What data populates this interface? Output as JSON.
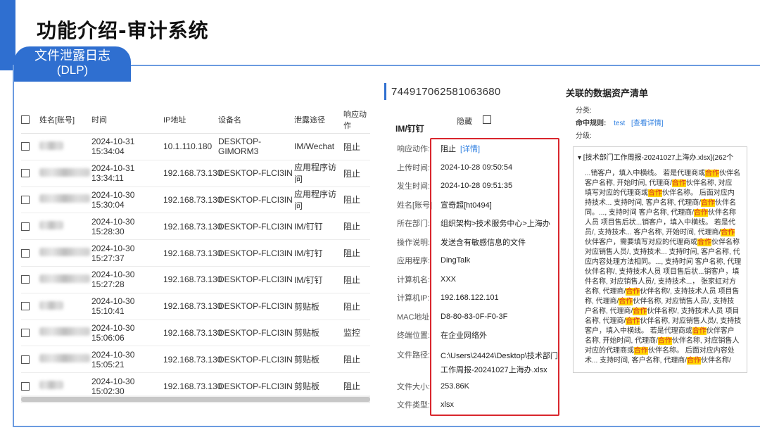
{
  "slide": {
    "title": "功能介绍-审计系统"
  },
  "badge": {
    "line1": "文件泄露日志",
    "line2": "(DLP)"
  },
  "table": {
    "headers": [
      "姓名[账号]",
      "时间",
      "IP地址",
      "设备名",
      "泄露途径",
      "响应动作"
    ],
    "rows": [
      {
        "time": "2024-10-31 15:34:04",
        "ip": "10.1.110.180",
        "device": "DESKTOP-GIMORM3",
        "path": "IM/Wechat",
        "action": "阻止"
      },
      {
        "time": "2024-10-31 13:34:11",
        "ip": "192.168.73.130",
        "device": "DESKTOP-FLCI3IN",
        "path": "应用程序访问",
        "action": "阻止"
      },
      {
        "time": "2024-10-30 15:30:04",
        "ip": "192.168.73.130",
        "device": "DESKTOP-FLCI3IN",
        "path": "应用程序访问",
        "action": "阻止"
      },
      {
        "time": "2024-10-30 15:28:30",
        "ip": "192.168.73.130",
        "device": "DESKTOP-FLCI3IN",
        "path": "IM/钉钉",
        "action": "阻止"
      },
      {
        "time": "2024-10-30 15:27:37",
        "ip": "192.168.73.130",
        "device": "DESKTOP-FLCI3IN",
        "path": "IM/钉钉",
        "action": "阻止"
      },
      {
        "time": "2024-10-30 15:27:28",
        "ip": "192.168.73.130",
        "device": "DESKTOP-FLCI3IN",
        "path": "IM/钉钉",
        "action": "阻止"
      },
      {
        "time": "2024-10-30 15:10:41",
        "ip": "192.168.73.130",
        "device": "DESKTOP-FLCI3IN",
        "path": "剪贴板",
        "action": "阻止"
      },
      {
        "time": "2024-10-30 15:06:06",
        "ip": "192.168.73.130",
        "device": "DESKTOP-FLCI3IN",
        "path": "剪贴板",
        "action": "监控"
      },
      {
        "time": "2024-10-30 15:05:21",
        "ip": "192.168.73.130",
        "device": "DESKTOP-FLCI3IN",
        "path": "剪贴板",
        "action": "阻止"
      },
      {
        "time": "2024-10-30 15:02:30",
        "ip": "192.168.73.130",
        "device": "DESKTOP-FLCI3IN",
        "path": "剪贴板",
        "action": "阻止"
      }
    ]
  },
  "detail": {
    "id": "744917062581063680",
    "hide_label": "隐藏",
    "section_title": "IM/钉钉",
    "fields": {
      "action": {
        "k": "响应动作:",
        "v": "阻止",
        "link": "[详情]"
      },
      "upload": {
        "k": "上传时间:",
        "v": "2024-10-28 09:50:54"
      },
      "occur": {
        "k": "发生时间:",
        "v": "2024-10-28 09:51:35"
      },
      "name": {
        "k": "姓名[账号]",
        "v": "宣奇超[ht0494]"
      },
      "dept": {
        "k": "所在部门:",
        "v": "组织架构>技术服务中心>上海办"
      },
      "op": {
        "k": "操作说明:",
        "v": "发送含有敏感信息的文件"
      },
      "app": {
        "k": "应用程序:",
        "v": "DingTalk"
      },
      "pc": {
        "k": "计算机名:",
        "v": "XXX"
      },
      "pcip": {
        "k": "计算机IP:",
        "v": "192.168.122.101"
      },
      "mac": {
        "k": "MAC地址:",
        "v": "D8-80-83-0F-F0-3F"
      },
      "loc": {
        "k": "终端位置:",
        "v": "在企业网络外"
      },
      "fpath": {
        "k": "文件路径:",
        "v": "C:\\Users\\24424\\Desktop\\技术部门工作周报-20241027上海办.xlsx"
      },
      "fsize": {
        "k": "文件大小:",
        "v": "253.86K"
      },
      "ftype": {
        "k": "文件类型:",
        "v": "xlsx"
      }
    }
  },
  "assets": {
    "title": "关联的数据资产清单",
    "category_label": "分类:",
    "rule_label": "命中规则:",
    "rule_value": "test",
    "rule_link": "[查看详情]",
    "level_label": "分级:",
    "file_head": "▾ [技术部门工作周报-20241027上海办.xlsx](262个",
    "snippet_lines": [
      [
        "...销客户，填入中横线。 若是代理商或",
        "合作",
        "伙伴名"
      ],
      [
        "客户名称, 开始时间, 代理商/",
        "合作",
        "伙伴名称, 对应"
      ],
      [
        "填写对应的代理商或",
        "合作",
        "伙伴名称。 后面对应内"
      ],
      [
        "持技术... 支持时间, 客户名称, 代理商/",
        "合作",
        "伙伴名"
      ],
      [
        "同。..., 支持时间 客户名称, 代理商/",
        "合作",
        "伙伴名称"
      ],
      [
        "人员 项目售后状...销客户，填入中横线。 若是代"
      ],
      [
        "员/, 支持技术... 客户名称, 开始时间, 代理商/",
        "合作",
        ""
      ],
      [
        "伙伴客户，需要填写对应的代理商或",
        "合作",
        "伙伴名称"
      ],
      [
        "对应销售人员/, 支持技术... 支持时间, 客户名称, 代"
      ],
      [
        "应内容处理方法相同。..., 支持时间 客户名称, 代理"
      ],
      [
        "伙伴名称/, 支持技术人员 项目售后状...销客户，填"
      ],
      [
        "件名称, 对应销售人员/, 支持技术...， 张家虹对方"
      ],
      [
        "名称, 代理商/",
        "合作",
        "伙伴名称/, 支持技术人员 项目售"
      ],
      [
        "称, 代理商/",
        "合作",
        "伙伴名称, 对应销售人员/, 支持技"
      ],
      [
        "户名称, 代理商/",
        "合作",
        "伙伴名称/, 支持技术人员 项目"
      ],
      [
        "名称, 代理商/",
        "合作",
        "伙伴名称, 对应销售人员/, 支持技"
      ],
      [
        "客户，填入中横线。 若是代理商或",
        "合作",
        "伙伴客户"
      ],
      [
        "名称, 开始时间, 代理商/",
        "合作",
        "伙伴名称, 对应销售人"
      ],
      [
        "对应的代理商或",
        "合作",
        "伙伴名称。 后面对应内容处"
      ],
      [
        "术... 支持时间, 客户名称, 代理商/",
        "合作",
        "伙伴名称/"
      ]
    ]
  }
}
